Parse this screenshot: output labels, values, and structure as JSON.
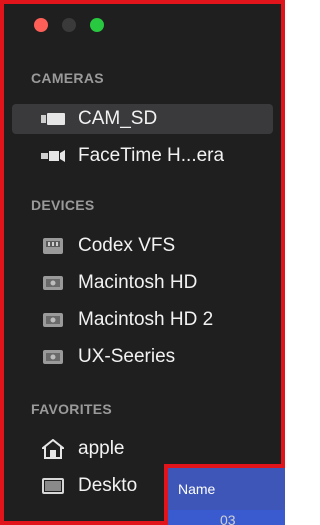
{
  "window": {
    "traffic_lights": [
      "close",
      "minimize",
      "zoom"
    ]
  },
  "sidebar": {
    "cameras": {
      "heading": "CAMERAS",
      "items": [
        {
          "label": "CAM_SD",
          "icon": "camera-icon",
          "selected": true
        },
        {
          "label": "FaceTime H...era",
          "icon": "camera-icon",
          "selected": false
        }
      ]
    },
    "devices": {
      "heading": "DEVICES",
      "items": [
        {
          "label": "Codex VFS",
          "icon": "disk-icon"
        },
        {
          "label": "Macintosh HD",
          "icon": "hard-drive-icon"
        },
        {
          "label": "Macintosh HD 2",
          "icon": "hard-drive-icon"
        },
        {
          "label": "UX-Seeries",
          "icon": "hard-drive-icon"
        }
      ]
    },
    "favorites": {
      "heading": "FAVORITES",
      "items": [
        {
          "label": "apple",
          "icon": "home-icon"
        },
        {
          "label": "Deskto",
          "icon": "desktop-icon"
        }
      ]
    }
  },
  "file_list": {
    "column_header": "Name",
    "rows": [
      {
        "name": "03"
      }
    ]
  },
  "colors": {
    "frame_border": "#e0141a",
    "sidebar_bg": "#1f1f1f",
    "selection": "#3a3a3c",
    "header_blue": "#3d56b8"
  }
}
